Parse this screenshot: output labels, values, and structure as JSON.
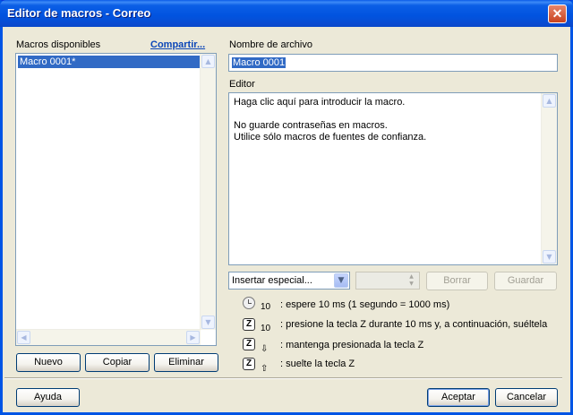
{
  "window": {
    "title": "Editor de macros - Correo",
    "close_glyph": "✕"
  },
  "macros": {
    "label": "Macros disponibles",
    "share_link": "Compartir...",
    "items": [
      "Macro 0001*"
    ],
    "buttons": {
      "new": "Nuevo",
      "copy": "Copiar",
      "delete": "Eliminar"
    }
  },
  "file": {
    "label": "Nombre de archivo",
    "value": "Macro 0001"
  },
  "editor": {
    "label": "Editor",
    "lines": [
      "Haga clic aquí para introducir la macro.",
      "",
      "No guarde contraseñas en macros.",
      "Utilice sólo macros de fuentes de confianza."
    ]
  },
  "toolbar": {
    "insert_special": "Insertar especial...",
    "stepper_value": "",
    "delete_label": "Borrar",
    "save_label": "Guardar"
  },
  "legend": [
    {
      "icon": "clock-icon",
      "sub": "10",
      "text": ": espere 10 ms (1 segundo = 1000 ms)"
    },
    {
      "icon": "key-z-icon",
      "key": "Z",
      "sub": "10",
      "text": ": presione la tecla Z durante 10 ms y, a continuación, suéltela"
    },
    {
      "icon": "key-z-down-icon",
      "key": "Z",
      "sub": "⇩",
      "text": ": mantenga presionada la tecla Z"
    },
    {
      "icon": "key-z-up-icon",
      "key": "Z",
      "sub": "⇧",
      "text": ": suelte la tecla Z"
    }
  ],
  "footer": {
    "help": "Ayuda",
    "ok": "Aceptar",
    "cancel": "Cancelar"
  }
}
